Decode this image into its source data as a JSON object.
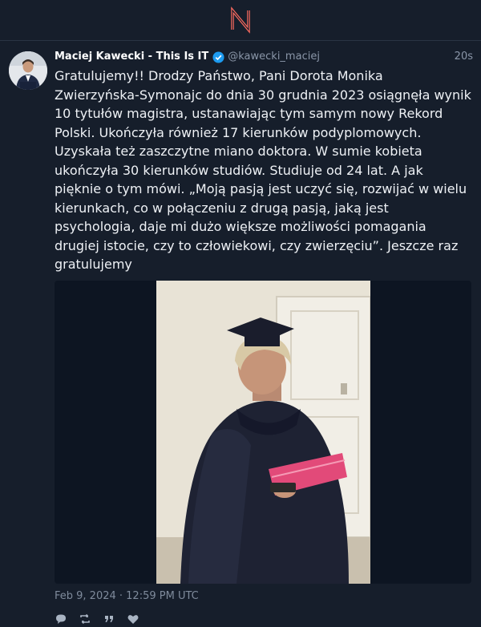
{
  "app": {
    "logo_icon": "nitter-n-logo",
    "accent": "#ff6c60"
  },
  "tweet": {
    "author_name": "Maciej Kawecki - This Is IT",
    "handle": "@kawecki_maciej",
    "verified": true,
    "time_ago": "20s",
    "text": "Gratulujemy!! Drodzy Państwo, Pani Dorota Monika Zwierzyńska-Symonajc do dnia 30 grudnia 2023 osiągnęła wynik 10 tytułów magistra, ustanawiając tym samym nowy Rekord Polski. Ukończyła również 17 kierunków podyplomowych. Uzyskała też zaszczytne miano doktora. W sumie kobieta ukończyła 30 kierunków studiów. Studiuje od 24 lat. A jak pięknie o tym mówi. „Moją pasją jest uczyć się, rozwijać w wielu kierunkach, co w połączeniu z drugą pasją, jaką jest psychologia, daje mi dużo większe możliwości pomagania drugiej istocie, czy to człowiekowi, czy zwierzęciu”. Jeszcze raz gratulujemy",
    "timestamp": "Feb 9, 2024 · 12:59 PM UTC",
    "actions": [
      "comment-icon",
      "retweet-icon",
      "quote-icon",
      "like-icon"
    ]
  }
}
